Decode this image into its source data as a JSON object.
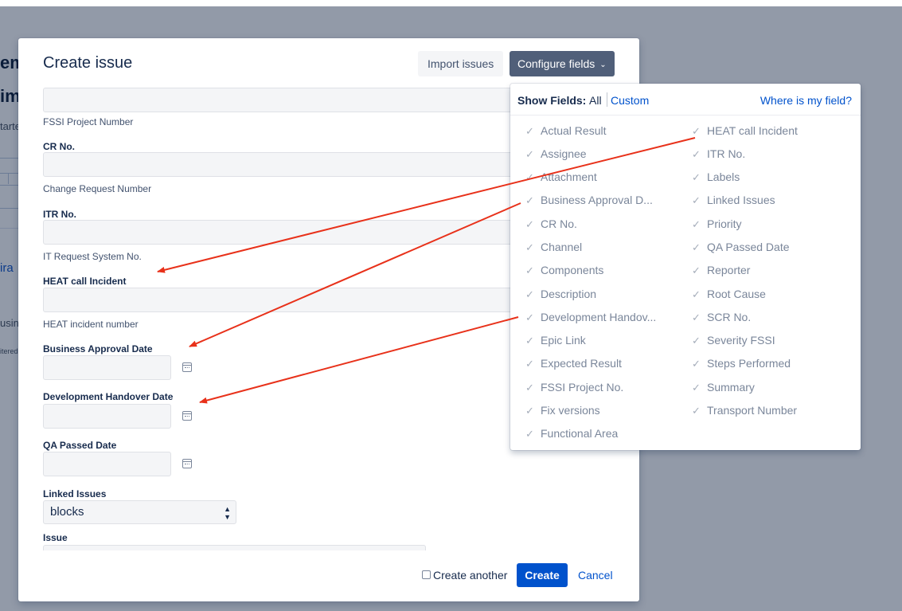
{
  "background": {
    "fragments": [
      "em",
      "im",
      "tarte",
      "ira",
      "usin",
      "itered"
    ]
  },
  "modal": {
    "title": "Create issue",
    "import_label": "Import issues",
    "configure_label": "Configure fields"
  },
  "form": {
    "fssi_desc": "FSSI Project Number",
    "cr_label": "CR No.",
    "cr_desc": "Change Request Number",
    "itr_label": "ITR No.",
    "itr_desc": "IT Request System No.",
    "heat_label": "HEAT call Incident",
    "heat_desc": "HEAT incident number",
    "business_label": "Business Approval Date",
    "dev_label": "Development Handover Date",
    "qa_label": "QA Passed Date",
    "linked_label": "Linked Issues",
    "linked_value": "blocks",
    "issue_label": "Issue"
  },
  "footer": {
    "create_another": "Create another",
    "create": "Create",
    "cancel": "Cancel"
  },
  "popover": {
    "show_fields": "Show Fields:",
    "all": "All",
    "custom": "Custom",
    "where": "Where is my field?",
    "col1": [
      "Actual Result",
      "Assignee",
      "Attachment",
      "Business Approval D...",
      "CR No.",
      "Channel",
      "Components",
      "Description",
      "Development Handov...",
      "Epic Link",
      "Expected Result",
      "FSSI Project No.",
      "Fix versions",
      "Functional Area"
    ],
    "col2": [
      "HEAT call Incident",
      "ITR No.",
      "Labels",
      "Linked Issues",
      "Priority",
      "QA Passed Date",
      "Reporter",
      "Root Cause",
      "SCR No.",
      "Severity FSSI",
      "Steps Performed",
      "Summary",
      "Transport Number"
    ]
  },
  "colors": {
    "primary": "#0052cc",
    "configure": "#505f79",
    "annotation": "#e8311a"
  }
}
